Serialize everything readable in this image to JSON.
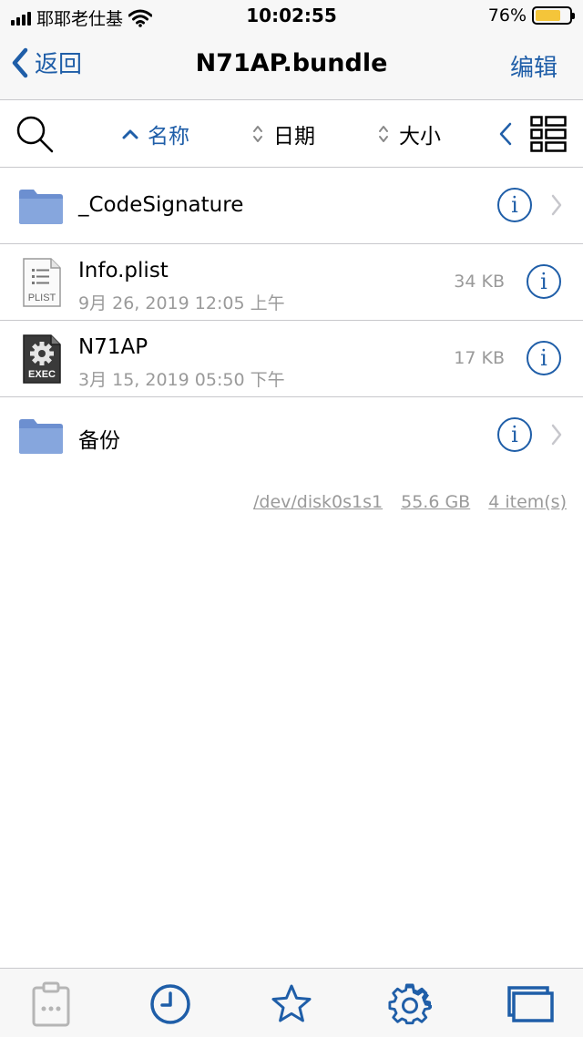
{
  "status_bar": {
    "carrier": "耶耶老仕基",
    "time": "10:02:55",
    "battery_percent": "76%",
    "battery_level": 0.76,
    "signal_icon": "signal-bars-icon",
    "wifi_icon": "wifi-icon"
  },
  "nav": {
    "back_label": "返回",
    "title": "N71AP.bundle",
    "edit_label": "编辑"
  },
  "toolbar": {
    "sort_name": "名称",
    "sort_date": "日期",
    "sort_size": "大小"
  },
  "files": [
    {
      "name": "_CodeSignature",
      "type": "folder"
    },
    {
      "name": "Info.plist",
      "type": "plist",
      "icon_label": "PLIST",
      "date": "9月 26, 2019 12:05 上午",
      "size": "34 KB"
    },
    {
      "name": "N71AP",
      "type": "exec",
      "icon_label": "EXEC",
      "date": "3月 15, 2019 05:50 下午",
      "size": "17 KB"
    },
    {
      "name": "备份",
      "type": "folder"
    }
  ],
  "footer": {
    "path": "/dev/disk0s1s1",
    "capacity": "55.6 GB",
    "count": "4 item(s)"
  },
  "info_glyph": "i",
  "colors": {
    "accent": "#1f5ea8",
    "folder": "#6c8fd0",
    "secondary_text": "#9a9a9a",
    "battery": "#f4c53a"
  }
}
